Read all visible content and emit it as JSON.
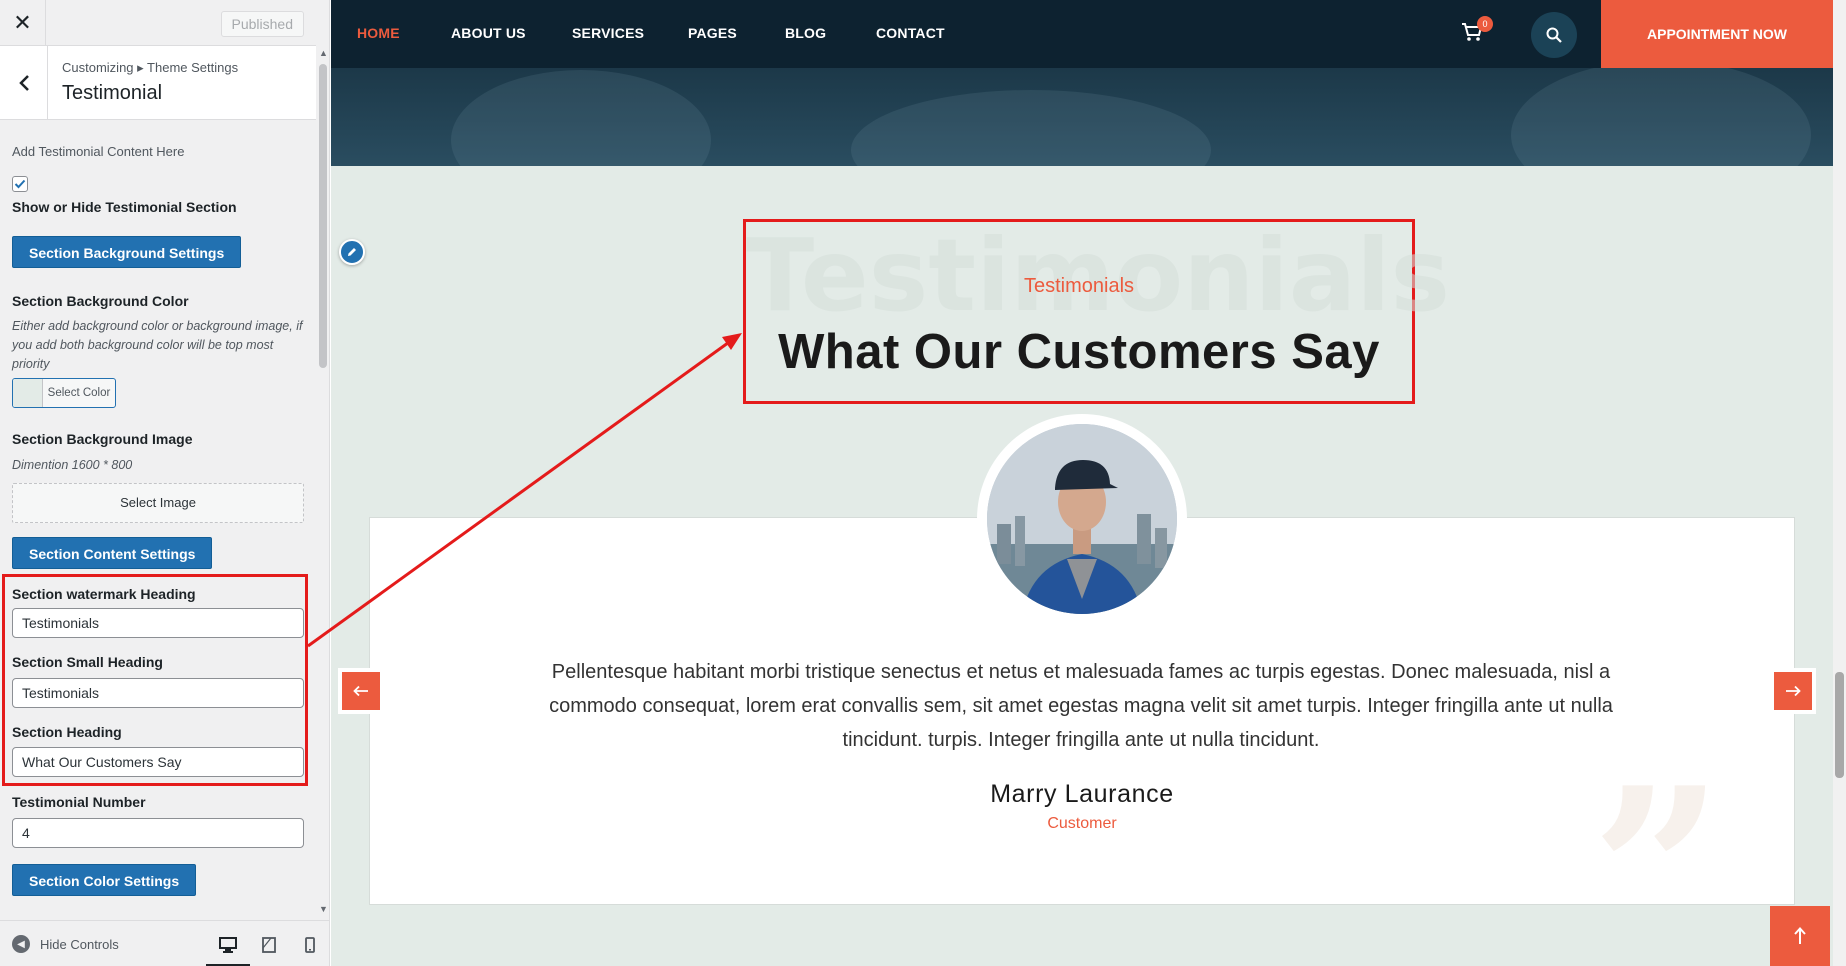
{
  "sidebar": {
    "close_label": "✕",
    "published_label": "Published",
    "breadcrumb": "Customizing ▸ Theme Settings",
    "title": "Testimonial",
    "intro": "Add Testimonial Content Here",
    "show_hide_checked": true,
    "show_hide_label": "Show or Hide Testimonial Section",
    "bg_settings_button": "Section Background Settings",
    "bg_color_label": "Section Background Color",
    "bg_color_desc": "Either add background color or background image, if you add both background color will be top most priority",
    "select_color_label": "Select Color",
    "bg_image_label": "Section Background Image",
    "bg_image_desc": "Dimention 1600 * 800",
    "select_image_label": "Select Image",
    "content_settings_button": "Section Content Settings",
    "watermark_heading_label": "Section watermark Heading",
    "watermark_heading_value": "Testimonials",
    "small_heading_label": "Section Small Heading",
    "small_heading_value": "Testimonials",
    "heading_label": "Section Heading",
    "heading_value": "What Our Customers Say",
    "testimonial_number_label": "Testimonial Number",
    "testimonial_number_value": "4",
    "color_settings_button": "Section Color Settings",
    "hide_controls_label": "Hide Controls",
    "devices": [
      "desktop-icon",
      "tablet-icon",
      "mobile-icon"
    ]
  },
  "nav": {
    "items": [
      "HOME",
      "ABOUT US",
      "SERVICES",
      "PAGES",
      "BLOG",
      "CONTACT"
    ],
    "active_index": 0,
    "cart_count": "0",
    "appointment_label": "APPOINTMENT NOW"
  },
  "testimonial": {
    "watermark": "Testimonials",
    "small_heading": "Testimonials",
    "heading": "What Our Customers Say",
    "quote": "Pellentesque habitant morbi tristique senectus et netus et malesuada fames ac turpis egestas. Donec malesuada, nisl a commodo consequat, lorem erat convallis sem, sit amet egestas magna velit sit amet turpis. Integer fringilla ante ut nulla tincidunt. turpis. Integer fringilla ante ut nulla tincidunt.",
    "name": "Marry Laurance",
    "role": "Customer"
  },
  "colors": {
    "accent": "#ec5b3e",
    "nav_bg": "#0d2230",
    "wp_blue": "#2271b1",
    "section_bg": "#e3ebe7",
    "annotation_red": "#e41b1b"
  }
}
